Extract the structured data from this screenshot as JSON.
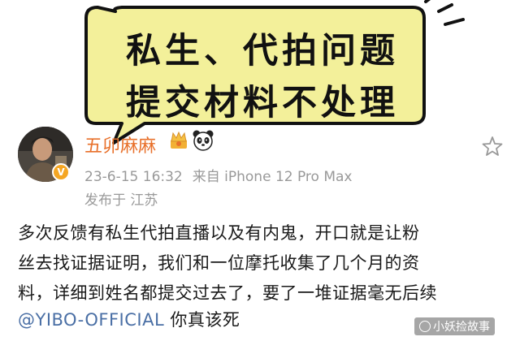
{
  "bubble": {
    "line1": "私生、代拍问题",
    "line2": "提交材料不处理"
  },
  "post": {
    "username": "五卯麻麻",
    "timestamp": "23-6-15 16:32",
    "source": "来自 iPhone 12 Pro Max",
    "location": "发布于 江苏",
    "body_line1": "多次反馈有私生代拍直播以及有内鬼，开口就是让粉",
    "body_line2": "丝去找证据证明，我们和一位摩托收集了几个月的资",
    "body_line3": "料，详细到姓名都提交过去了，要了一堆证据毫无后续",
    "mention": "@YIBO-OFFICIAL",
    "body_line4_rest": " 你真该死"
  },
  "watermark": "小妖捡故事",
  "icons": {
    "badge": "verified-badge-icon",
    "crown": "crown-emoji-icon",
    "panda": "panda-emoji-icon",
    "star": "star-icon"
  },
  "colors": {
    "bubble_fill": "#f3f09a",
    "username": "#e8702a",
    "mention": "#4a6fa5",
    "meta": "#999999"
  }
}
